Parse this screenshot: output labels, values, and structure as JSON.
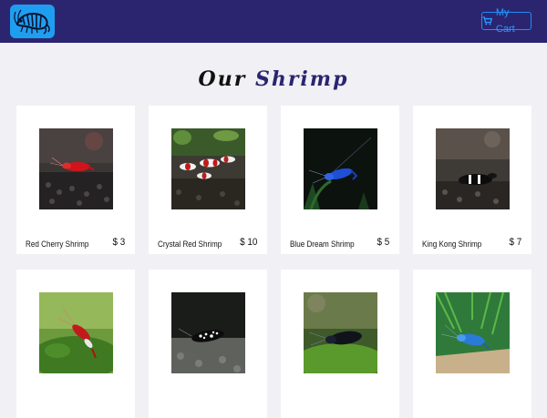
{
  "header": {
    "logo_icon": "shrimp-logo-icon",
    "cart_icon": "cart-icon",
    "cart_label": "My Cart",
    "colors": {
      "navbar": "#2b2570",
      "logo": "#1f9ef0",
      "cart": "#2a96ff"
    }
  },
  "main": {
    "title_part1": "Our",
    "title_part2": "Shrimp",
    "products": [
      {
        "name": "Red Cherry Shrimp",
        "price": "$ 3",
        "image": "red-cherry-shrimp-photo"
      },
      {
        "name": "Crystal Red Shrimp",
        "price": "$ 10",
        "image": "crystal-red-shrimp-photo"
      },
      {
        "name": "Blue Dream Shrimp",
        "price": "$ 5",
        "image": "blue-dream-shrimp-photo"
      },
      {
        "name": "King Kong Shrimp",
        "price": "$ 7",
        "image": "king-kong-shrimp-photo"
      },
      {
        "image": "red-shrimp-on-moss-photo"
      },
      {
        "image": "black-white-shrimp-photo"
      },
      {
        "image": "dark-shrimp-on-moss-photo"
      },
      {
        "image": "blue-shrimp-on-plant-photo"
      }
    ]
  }
}
